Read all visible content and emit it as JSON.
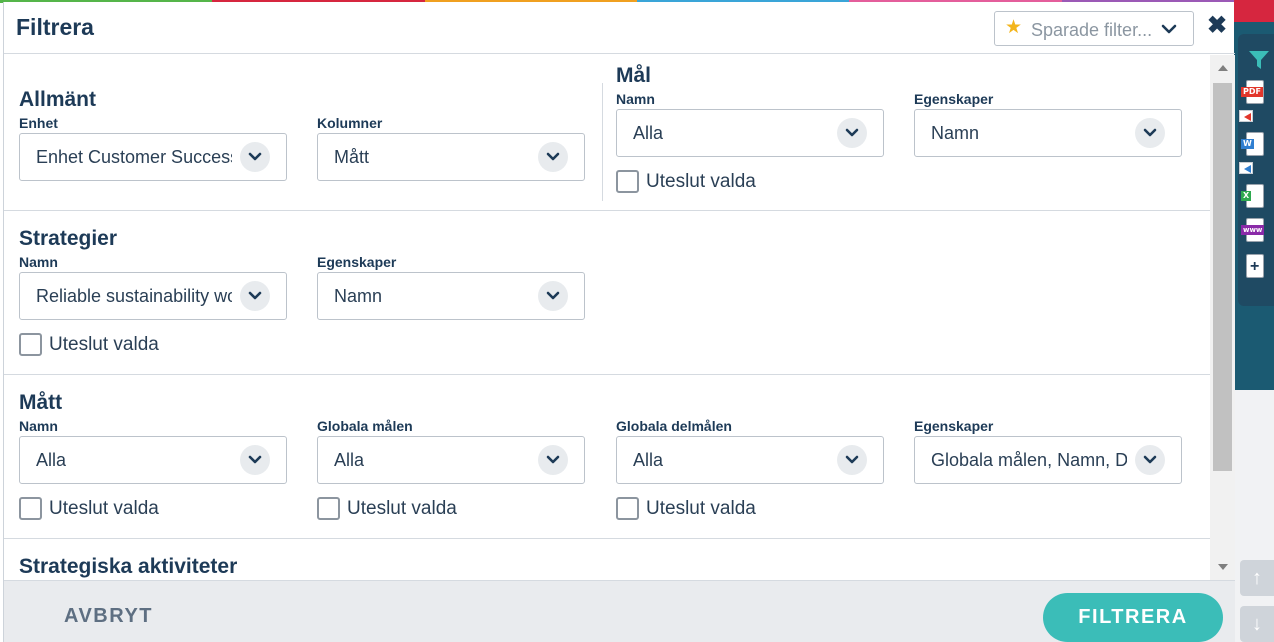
{
  "modal": {
    "title": "Filtrera",
    "saved_filters_placeholder": "Sparade filter...",
    "close_label": "✖"
  },
  "sections": {
    "allmant": {
      "title": "Allmänt",
      "enhet_label": "Enhet",
      "enhet_value": "Enhet Customer Success",
      "kolumner_label": "Kolumner",
      "kolumner_value": "Mått"
    },
    "mal": {
      "title": "Mål",
      "namn_label": "Namn",
      "namn_value": "Alla",
      "egenskaper_label": "Egenskaper",
      "egenskaper_value": "Namn",
      "exclude_label": "Uteslut valda"
    },
    "strategier": {
      "title": "Strategier",
      "namn_label": "Namn",
      "namn_value": "Reliable sustainability work",
      "egenskaper_label": "Egenskaper",
      "egenskaper_value": "Namn",
      "exclude_label": "Uteslut valda"
    },
    "matt": {
      "title": "Mått",
      "namn_label": "Namn",
      "namn_value": "Alla",
      "globala_malen_label": "Globala målen",
      "globala_malen_value": "Alla",
      "globala_delmalen_label": "Globala delmålen",
      "globala_delmalen_value": "Alla",
      "egenskaper_label": "Egenskaper",
      "egenskaper_value": "Globala målen, Namn, D",
      "exclude_label": "Uteslut valda"
    },
    "strategiska": {
      "title": "Strategiska aktiviteter"
    }
  },
  "footer": {
    "cancel_label": "AVBRYT",
    "filter_label": "FILTRERA"
  },
  "side_tools": {
    "pdf_label": "PDF",
    "word_label": "W",
    "excel_label": "X",
    "web_label": "www"
  },
  "colors": {
    "accent": "#3bbdb8",
    "title": "#1d3a57",
    "star": "#f3b51c"
  },
  "icons": [
    "star-icon",
    "chevron-down-icon",
    "close-icon",
    "filter-icon",
    "pdf-icon",
    "word-icon",
    "excel-icon",
    "web-icon",
    "add-document-icon",
    "arrow-up-icon",
    "arrow-down-icon"
  ]
}
